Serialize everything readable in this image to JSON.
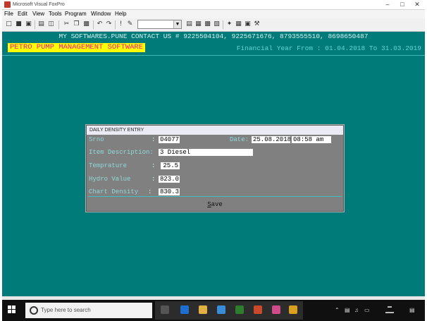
{
  "window": {
    "title": "Microsoft Visual FoxPro"
  },
  "menu": [
    "File",
    "Edit",
    "View",
    "Tools",
    "Program",
    "Window",
    "Help"
  ],
  "app": {
    "contact": "MY SOFTWARES.PUNE CONTACT US # 9225504104, 9225671676, 8793555510, 8698650487",
    "banner": "PETRO PUMP MANAGEMENT SOFTWARE",
    "financial_year": "Financial Year From : 01.04.2018 To 31.03.2019"
  },
  "dialog": {
    "title": "DAILY DENSITY ENTRY",
    "srno_label": "Srno",
    "srno_value": "04077",
    "date_label": "Date:",
    "date_value": "25.08.2018",
    "time_value": "08:58 am",
    "item_label": "Item Description:",
    "item_value": "3 Diesel",
    "temp_label": "Temprature",
    "temp_value": "25.5",
    "hydro_label": "Hydro Value",
    "hydro_value": "823.0",
    "chart_label": "Chart Density",
    "chart_value": "830.3",
    "colon": ":",
    "save_hotkey": "S",
    "save_rest": "ave"
  },
  "taskbar": {
    "search_placeholder": "Type here to search",
    "colors": {
      "bg": "#101010",
      "desktop": "#007b7a",
      "banner": "#ffff00",
      "banner_text": "#ff1493"
    }
  }
}
